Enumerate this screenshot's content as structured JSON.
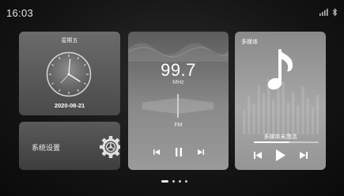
{
  "status_bar": {
    "time": "16:03",
    "icons": [
      "signal-icon",
      "bluetooth-icon"
    ]
  },
  "date_card": {
    "weekday": "星期五",
    "date": "2020-08-21",
    "clock_icon": "analog-clock-icon"
  },
  "settings_card": {
    "label": "系统设置",
    "icon": "gear-icon"
  },
  "radio_card": {
    "frequency": "99.7",
    "unit": "MHz",
    "band": "FM",
    "controls": [
      "previous-icon",
      "pause-icon",
      "next-icon"
    ]
  },
  "media_card": {
    "title": "多媒体",
    "status": "多媒体未激活",
    "progress_fraction": 0.55,
    "controls": [
      "previous-icon",
      "play-icon",
      "next-icon"
    ]
  },
  "pager": {
    "page_count": 4,
    "active_page": 0
  },
  "colors": {
    "background": "#141414",
    "card_light": "#9a9a9a",
    "card_dark": "#4a4a4a",
    "text": "#ffffff"
  }
}
